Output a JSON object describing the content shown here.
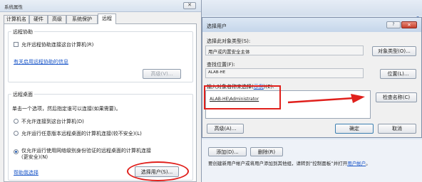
{
  "system_window": {
    "title": "系统属性",
    "tabs": [
      "计算机名",
      "硬件",
      "高级",
      "系统保护",
      "远程"
    ],
    "remote_assistance": {
      "section_label": "远程协助",
      "checkbox_label": "允许远程协助连接这台计算机(R)",
      "link": "有关启用远程协助的信息",
      "advanced_button": "高级(V)..."
    },
    "remote_desktop": {
      "section_label": "远程桌面",
      "instruction": "单击一个选项，然后指定谁可以连接(如果需要)。",
      "options": [
        "不允许连接到这台计算机(D)",
        "允许运行任意版本远程桌面的计算机连接(较不安全)(L)",
        "仅允许运行使用网络级别身份验证的远程桌面的计算机连接(更安全)(N)"
      ],
      "help_link": "帮助我选择",
      "select_users_button": "选择用户(S)..."
    }
  },
  "back_window": {
    "add_button": "添加(D)...",
    "delete_button": "删除(R)",
    "footer_text": "要创建新用户帐户或将用户添加到其他组，请转到“控制面板”并打开",
    "footer_link": "用户帐户",
    "footer_end": "。"
  },
  "select_users_dialog": {
    "title": "选择用户",
    "object_type_label": "选择此对象类型(S):",
    "object_type_value": "用户或内置安全主体",
    "object_type_button": "对象类型(O)...",
    "location_label": "查找位置(F):",
    "location_value": "ALAB-HE",
    "location_button": "位置(L)...",
    "names_label_prefix": "输入对象名称来选择(",
    "names_label_link": "示例",
    "names_label_suffix": ")(E):",
    "names_value": "ALAB-HE\\Administrator",
    "check_names_button": "检查名称(C)",
    "advanced_button": "高级(A)...",
    "ok_button": "确定",
    "cancel_button": "取消"
  },
  "colors": {
    "annotation_red": "#e0201c",
    "accent_blue": "#1a56c8"
  }
}
